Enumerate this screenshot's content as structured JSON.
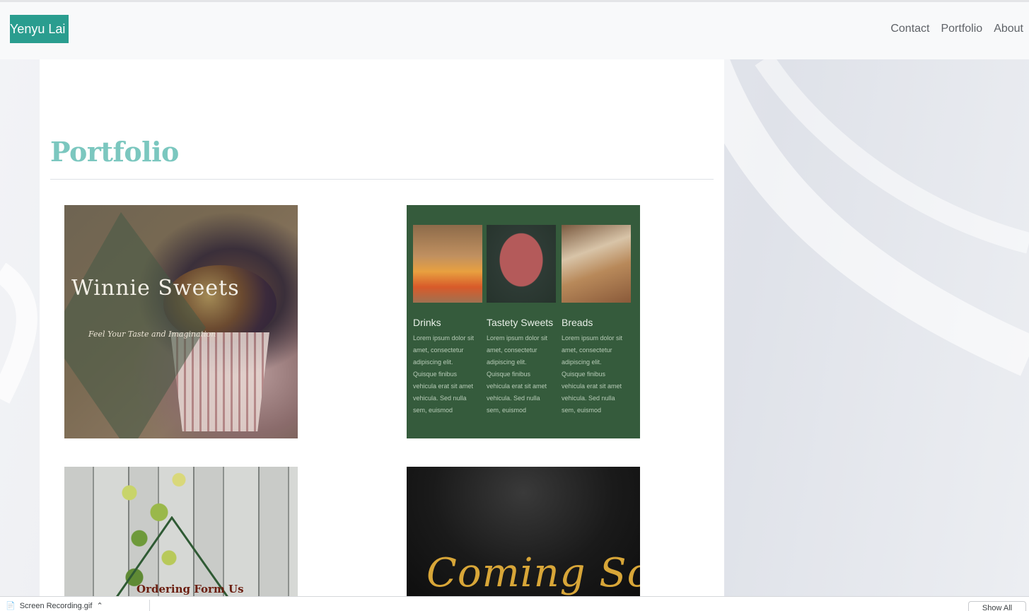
{
  "navbar": {
    "brand": "Yenyu Lai",
    "links": [
      "Contact",
      "Portfolio",
      "About"
    ]
  },
  "main": {
    "title": "Portfolio",
    "cards": [
      {
        "title": "Winnie Sweets",
        "subtitle": "Feel Your Taste and Imagination"
      },
      {
        "menu": [
          {
            "heading": "Drinks",
            "body": "Lorem ipsum dolor sit amet, consectetur adipiscing elit. Quisque finibus vehicula erat sit amet vehicula. Sed nulla sem, euismod"
          },
          {
            "heading": "Tastety Sweets",
            "body": "Lorem ipsum dolor sit amet, consectetur adipiscing elit. Quisque finibus vehicula erat sit amet vehicula. Sed nulla sem, euismod"
          },
          {
            "heading": "Breads",
            "body": "Lorem ipsum dolor sit amet, consectetur adipiscing elit. Quisque finibus vehicula erat sit amet vehicula. Sed nulla sem, euismod"
          }
        ]
      },
      {
        "title": "Ordering Form Us"
      },
      {
        "title": "Coming Soon"
      }
    ]
  },
  "download_bar": {
    "file_name": "Screen Recording.gif",
    "show_all": "Show All"
  },
  "colors": {
    "brand_bg": "#2a9d8f",
    "title": "#7bc7bf",
    "menu_bg": "#355b3c",
    "gold": "#d8a638"
  }
}
